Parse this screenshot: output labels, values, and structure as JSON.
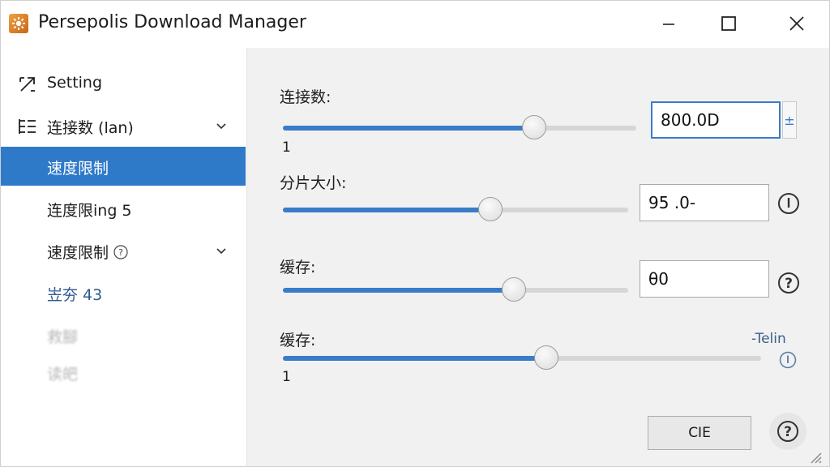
{
  "window": {
    "title": "Persepolis Download Manager"
  },
  "sidebar": {
    "items": [
      {
        "label": "Setting"
      },
      {
        "label": "连接数 (lan)"
      },
      {
        "label": "速度限制"
      },
      {
        "label": "连度限ing 5"
      },
      {
        "label": "速度限制"
      },
      {
        "label": "岦夯 43"
      },
      {
        "label": "救腳"
      },
      {
        "label": "读皅"
      }
    ]
  },
  "main": {
    "rows": [
      {
        "label": "连接数:",
        "min_label": "1",
        "value_text": "800.0D",
        "spin_symbol": "±",
        "slider_fraction": 0.71
      },
      {
        "label": "分片大小:",
        "value_text": "95 .0-",
        "slider_fraction": 0.6
      },
      {
        "label": "缓存:",
        "value_text": "θ0",
        "slider_fraction": 0.67
      },
      {
        "label": "缓存:",
        "min_label": "1",
        "link_text": "-Telin",
        "slider_fraction": 0.55
      }
    ],
    "button_label": "CIE"
  }
}
